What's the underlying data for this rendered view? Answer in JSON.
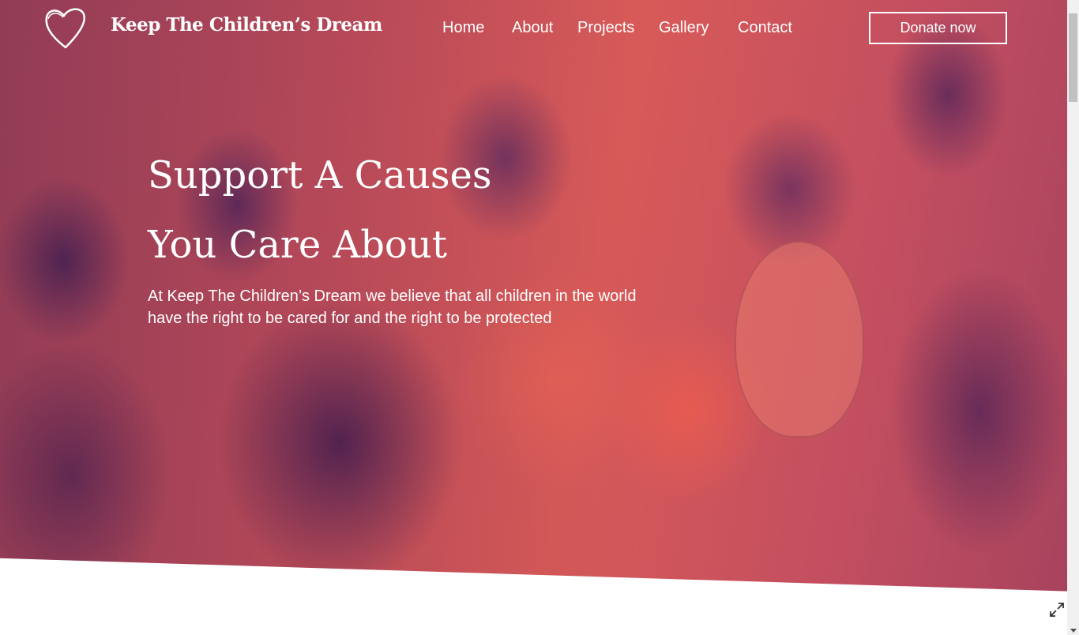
{
  "brand": {
    "name": "Keep The Children’s Dream",
    "logo_icon": "heart-outline-icon"
  },
  "nav": {
    "items": [
      {
        "label": "Home"
      },
      {
        "label": "About"
      },
      {
        "label": "Projects"
      },
      {
        "label": "Gallery"
      },
      {
        "label": "Contact"
      }
    ],
    "donate_label": "Donate now"
  },
  "hero": {
    "headline_line1": "Support A Causes",
    "headline_line2": "You Care About",
    "subtext": "At Keep The Children’s Dream we believe that all children in the world have the right to be cared for and the right to be protected",
    "overlay_colors": [
      "#e45a55",
      "#3b1f5c"
    ]
  },
  "controls": {
    "expand_icon": "expand-icon"
  }
}
